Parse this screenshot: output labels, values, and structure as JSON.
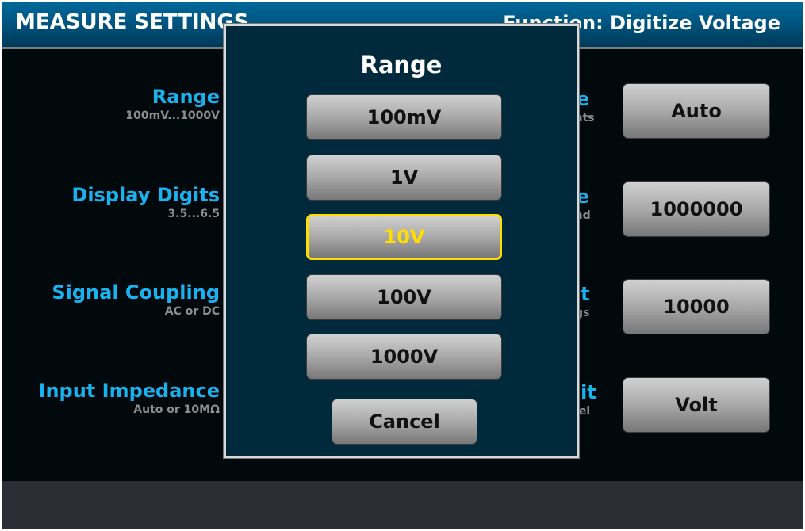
{
  "header": {
    "title": "MEASURE SETTINGS",
    "function": "Function: Digitize Voltage"
  },
  "left_settings": [
    {
      "label": "Range",
      "hint": "100mV...1000V"
    },
    {
      "label": "Display Digits",
      "hint": "3.5...6.5"
    },
    {
      "label": "Signal Coupling",
      "hint": "AC or DC"
    },
    {
      "label": "Input Impedance",
      "hint": "Auto or 10MΩ"
    }
  ],
  "right_settings": [
    {
      "label_partial": "re",
      "hint_partial": "ents",
      "value": "Auto"
    },
    {
      "label_partial": "te",
      "hint_partial": "ond",
      "value": "1000000"
    },
    {
      "label_partial": "nt",
      "hint_partial": "ngs",
      "value": "10000"
    },
    {
      "label_partial": "nit",
      "hint_partial": "ibel",
      "value": "Volt"
    }
  ],
  "dialog": {
    "title": "Range",
    "options": [
      "100mV",
      "1V",
      "10V",
      "100V",
      "1000V"
    ],
    "selected": "10V",
    "cancel_label": "Cancel"
  },
  "colors": {
    "accent_label": "#1ab2ee",
    "selected_highlight": "#ffdd00",
    "dialog_bg": "#002a3b",
    "header_bg": "#00689a"
  }
}
